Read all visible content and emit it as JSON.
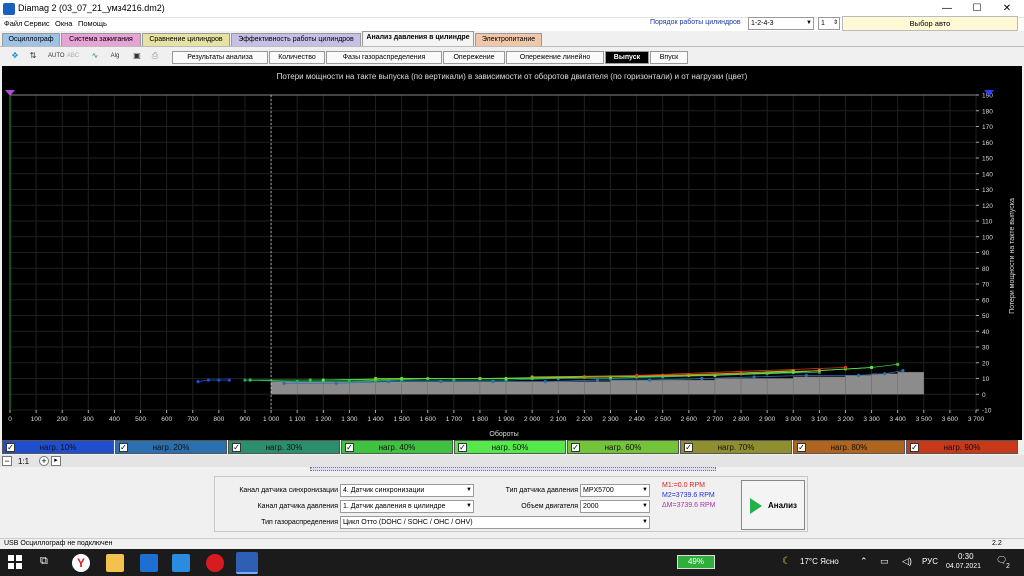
{
  "window": {
    "title": "Diamag 2 (03_07_21_умз4216.dm2)",
    "minimize": "—",
    "maximize": "☐",
    "close": "✕"
  },
  "menu": [
    "Файл",
    "Сервис",
    "Окна",
    "Помощь"
  ],
  "firing_order": {
    "label": "Порядок работы цилиндров",
    "value": "1-2-4-3",
    "count": "1"
  },
  "auto_select": "Выбор авто",
  "main_tabs": [
    {
      "label": "Осциллограф",
      "color": "#9ec3e6"
    },
    {
      "label": "Система зажигания",
      "color": "#e7a3d6"
    },
    {
      "label": "Сравнение цилиндров",
      "color": "#e6e2a2"
    },
    {
      "label": "Эффективность работы цилиндров",
      "color": "#c6bfe6"
    },
    {
      "label": "Анализ давления в цилиндре",
      "color": "#f4f4f4"
    },
    {
      "label": "Электропитание",
      "color": "#f0c7a8"
    }
  ],
  "sub_tabs": [
    "Результаты анализа",
    "Количество",
    "Фазы газораспределения",
    "Опережение",
    "Опережение линейно",
    "Выпуск",
    "Впуск"
  ],
  "toolbar_icons": [
    "zoom-fit-icon",
    "scale-icon",
    "auto-icon",
    "abc-icon",
    "graph-icon",
    "algorithm-icon",
    "save-icon",
    "print-icon"
  ],
  "chart_data": {
    "type": "scatter",
    "title": "Потери мощности на такте выпуска (по вертикали) в зависимости от оборотов двигателя (по горизонтали) и от нагрузки (цвет)",
    "xlabel": "Обороты",
    "ylabel": "Потери мощности на такте выпуска",
    "xlim": [
      0,
      3700
    ],
    "ylim": [
      -10,
      190
    ],
    "x_ticks": [
      0,
      100,
      200,
      300,
      400,
      500,
      600,
      700,
      800,
      900,
      1000,
      1100,
      1200,
      1300,
      1400,
      1500,
      1600,
      1700,
      1800,
      1900,
      2000,
      2100,
      2200,
      2300,
      2400,
      2500,
      2600,
      2700,
      2800,
      2900,
      3000,
      3100,
      3200,
      3300,
      3400,
      3500,
      3600,
      3700
    ],
    "x_tick_labels": [
      "0",
      "100",
      "200",
      "300",
      "400",
      "500",
      "600",
      "700",
      "800",
      "900",
      "1 000",
      "1 100",
      "1 200",
      "1 300",
      "1 400",
      "1 500",
      "1 600",
      "1 700",
      "1 800",
      "1 900",
      "2 000",
      "2 100",
      "2 200",
      "2 300",
      "2 400",
      "2 500",
      "2 600",
      "2 700",
      "2 800",
      "2 900",
      "3 000",
      "3 100",
      "3 200",
      "3 300",
      "3 400",
      "3 500",
      "3 600",
      "3 700"
    ],
    "y_ticks": [
      190,
      180,
      170,
      160,
      150,
      140,
      130,
      120,
      110,
      100,
      90,
      80,
      70,
      60,
      50,
      40,
      30,
      20,
      10,
      0,
      -10
    ],
    "marker_x": 1000,
    "bars": {
      "x_start": 1000,
      "x_end": 3500,
      "step": 100,
      "values": [
        8,
        8,
        8,
        8,
        8,
        8,
        8,
        8,
        8,
        8,
        8,
        8,
        8,
        9,
        9,
        9,
        9,
        10,
        10,
        10,
        11,
        11,
        12,
        13,
        14
      ]
    },
    "series": [
      {
        "name": "нагр. 10%",
        "color": "#1c4fd8",
        "points": [
          [
            720,
            8
          ],
          [
            760,
            9
          ],
          [
            800,
            9
          ],
          [
            840,
            9
          ]
        ]
      },
      {
        "name": "нагр. 20%",
        "color": "#2d6fb5",
        "points": [
          [
            1050,
            7
          ],
          [
            1250,
            7
          ],
          [
            1450,
            8
          ],
          [
            1650,
            8
          ],
          [
            1850,
            8
          ],
          [
            2050,
            8
          ],
          [
            2250,
            9
          ],
          [
            2450,
            9
          ],
          [
            2650,
            10
          ],
          [
            2850,
            11
          ],
          [
            3050,
            12
          ],
          [
            3250,
            12
          ],
          [
            3350,
            13
          ],
          [
            3420,
            15
          ]
        ]
      },
      {
        "name": "нагр. 30%",
        "color": "#2a9e7a",
        "points": [
          [
            900,
            9
          ],
          [
            1100,
            8
          ],
          [
            1300,
            8
          ],
          [
            1500,
            9
          ],
          [
            1700,
            9
          ],
          [
            1900,
            9
          ],
          [
            2100,
            10
          ],
          [
            2300,
            10
          ],
          [
            2500,
            11
          ],
          [
            2700,
            12
          ],
          [
            2900,
            13
          ],
          [
            3100,
            14
          ]
        ]
      },
      {
        "name": "нагр. 40%",
        "color": "#33cc33",
        "points": [
          [
            920,
            9
          ],
          [
            1150,
            9
          ],
          [
            1400,
            9
          ],
          [
            1600,
            10
          ],
          [
            1800,
            10
          ],
          [
            2000,
            10
          ],
          [
            2200,
            11
          ],
          [
            2400,
            11
          ],
          [
            2600,
            12
          ],
          [
            2800,
            13
          ],
          [
            3000,
            14
          ],
          [
            3200,
            16
          ],
          [
            3300,
            17
          ],
          [
            3400,
            19
          ]
        ]
      },
      {
        "name": "нагр. 50%",
        "color": "#55ee44",
        "points": [
          [
            1200,
            9
          ],
          [
            1500,
            10
          ],
          [
            1900,
            10
          ],
          [
            2300,
            11
          ],
          [
            2700,
            12
          ],
          [
            3000,
            14
          ],
          [
            3300,
            17
          ]
        ]
      },
      {
        "name": "нагр. 60%",
        "color": "#88cc22",
        "points": [
          [
            1400,
            10
          ],
          [
            1800,
            10
          ],
          [
            2200,
            11
          ],
          [
            2600,
            12
          ],
          [
            3000,
            15
          ]
        ]
      },
      {
        "name": "нагр. 70%",
        "color": "#b8a030",
        "points": [
          [
            2000,
            11
          ],
          [
            2500,
            12
          ],
          [
            3100,
            15
          ]
        ]
      },
      {
        "name": "нагр. 80%",
        "color": "#d07a20",
        "points": [
          [
            2200,
            11
          ],
          [
            2800,
            13
          ]
        ]
      },
      {
        "name": "нагр. 90%",
        "color": "#e03a1a",
        "points": [
          [
            2400,
            12
          ],
          [
            3200,
            17
          ]
        ]
      }
    ]
  },
  "legend": [
    {
      "label": "нагр. 10%",
      "color": "#1f4fcf"
    },
    {
      "label": "нагр. 20%",
      "color": "#2a6fb0"
    },
    {
      "label": "нагр. 30%",
      "color": "#2b8f6e"
    },
    {
      "label": "нагр. 40%",
      "color": "#3fc23f"
    },
    {
      "label": "нагр. 50%",
      "color": "#55e84a"
    },
    {
      "label": "нагр. 60%",
      "color": "#74c43a"
    },
    {
      "label": "нагр. 70%",
      "color": "#8f8f2f"
    },
    {
      "label": "нагр. 80%",
      "color": "#b0651e"
    },
    {
      "label": "нагр. 90%",
      "color": "#c8391a"
    }
  ],
  "zoom": {
    "minus": "−",
    "value": "1:1",
    "plus": "+",
    "more": "▸"
  },
  "settings": {
    "sync_label": "Канал датчика синхронизации",
    "sync_value": "4.  Датчик синхронизации",
    "pressure_label": "Канал датчика давления",
    "pressure_value": "1.  Датчик давления в цилиндре",
    "timing_label": "Тип газораспределения",
    "timing_value": "Цикл Отто (DOHC / SOHC / OHC / OHV)",
    "sensor_type_label": "Тип датчика давления",
    "sensor_type_value": "MPX5700",
    "volume_label": "Объем двигателя",
    "volume_value": "2000"
  },
  "markers": {
    "m1": "M1:=0.0 RPM",
    "m2": "M2=3739.6 RPM",
    "dm": "ΔM=3739.6 RPM"
  },
  "analyze_button": "Анализ",
  "status": {
    "left": "USB Осциллограф не подключен",
    "right": "2.2"
  },
  "taskbar": {
    "battery": "49%",
    "weather": "17°C Ясно",
    "lang": "РУС",
    "time": "0:30",
    "date": "04.07.2021",
    "notif": "2"
  }
}
